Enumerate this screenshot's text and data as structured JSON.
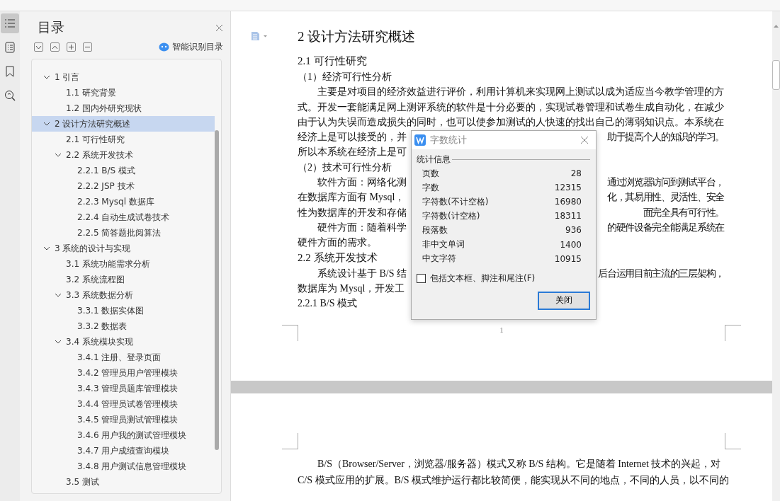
{
  "toc": {
    "title": "目录",
    "smart_button": "智能识别目录",
    "items": [
      {
        "label": "1  引言",
        "expanded": true,
        "selected": false,
        "children": [
          {
            "label": "1.1  研究背景",
            "selected": false
          },
          {
            "label": "1.2  国内外研究现状",
            "selected": false
          }
        ]
      },
      {
        "label": "2  设计方法研究概述",
        "expanded": true,
        "selected": true,
        "children": [
          {
            "label": "2.1  可行性研究",
            "selected": false
          },
          {
            "label": "2.2  系统开发技术",
            "expanded": true,
            "selected": false,
            "children": [
              {
                "label": "2.2.1    B/S 模式",
                "selected": false
              },
              {
                "label": "2.2.2 JSP 技术",
                "selected": false
              },
              {
                "label": "2.2.3 Mysql 数据库",
                "selected": false
              },
              {
                "label": "2.2.4  自动生成试卷技术",
                "selected": false
              },
              {
                "label": "2.2.5  简答题批阅算法",
                "selected": false
              }
            ]
          }
        ]
      },
      {
        "label": "3  系统的设计与实现",
        "expanded": true,
        "selected": false,
        "children": [
          {
            "label": "3.1  系统功能需求分析",
            "selected": false
          },
          {
            "label": "3.2  系统流程图",
            "selected": false
          },
          {
            "label": "3.3  系统数据分析",
            "expanded": true,
            "selected": false,
            "children": [
              {
                "label": "3.3.1    数据实体图",
                "selected": false
              },
              {
                "label": "3.3.2    数据表",
                "selected": false
              }
            ]
          },
          {
            "label": "3.4  系统模块实现",
            "expanded": true,
            "selected": false,
            "children": [
              {
                "label": "3.4.1  注册、登录页面",
                "selected": false
              },
              {
                "label": "3.4.2  管理员用户管理模块",
                "selected": false
              },
              {
                "label": "3.4.3  管理员题库管理模块",
                "selected": false
              },
              {
                "label": "3.4.4  管理员试卷管理模块",
                "selected": false
              },
              {
                "label": "3.4.5  管理员测试管理模块",
                "selected": false
              },
              {
                "label": "3.4.6 用户我的测试管理模块",
                "selected": false
              },
              {
                "label": "3.4.7 用户成绩查询模块",
                "selected": false
              },
              {
                "label": "3.4.8 用户测试信息管理模块",
                "selected": false
              }
            ]
          },
          {
            "label": "3.5  测试",
            "selected": false
          }
        ]
      }
    ]
  },
  "document": {
    "page1_lines": [
      {
        "kind": "h1",
        "text": "2  设计方法研究概述"
      },
      {
        "kind": "h2",
        "text": "2.1  可行性研究"
      },
      {
        "kind": "line",
        "text": "（1）经济可行性分析"
      },
      {
        "kind": "indent",
        "text": "主要是对项目的经济效益进行评价，利用计算机来实现网上测试以成为适应当今教学管理的方"
      },
      {
        "kind": "line",
        "text": "式。开发一套能满足网上测评系统的软件是十分必要的，实现试卷管理和试卷生成自动化，在减少"
      },
      {
        "kind": "line",
        "text": "由于认为失误而造成损失的同时，也可以使参加测试的人快速的找出自己的薄弱知识点。本系统在"
      },
      {
        "kind": "line",
        "text": "经济上是可以接受的，并",
        "right": "助于提高个人的知识的学习。"
      },
      {
        "kind": "line",
        "text": "所以本系统在经济上是可"
      },
      {
        "kind": "line",
        "text": "（2）技术可行性分析"
      },
      {
        "kind": "indent",
        "text": "软件方面：网络化测",
        "right": "通过浏览器访问到测试平台，"
      },
      {
        "kind": "line",
        "text": "在数据库方面有 Mysql，",
        "right": "化，其易用性、灵活性、安全"
      },
      {
        "kind": "line",
        "text": "性为数据库的开发和存储",
        "right": "面完全具有可行性。"
      },
      {
        "kind": "indent",
        "text": "硬件方面：随着科学",
        "right": "的硬件设备完全能满足系统在"
      },
      {
        "kind": "line",
        "text": "硬件方面的需求。"
      },
      {
        "kind": "h2",
        "text": "2.2  系统开发技术"
      },
      {
        "kind": "indent",
        "text": "系统设计基于 B/S 结",
        "right": "后台运用目前主流的三层架构，"
      },
      {
        "kind": "line",
        "text": "数据库为 Mysql，开发工"
      },
      {
        "kind": "line",
        "text": "2.2.1    B/S 模式"
      }
    ],
    "page_number": "1",
    "page2_lines": [
      {
        "kind": "indent",
        "text": "B/S（Browser/Server，浏览器/服务器）模式又称 B/S 结构。它是随着 Internet 技术的兴起，对"
      },
      {
        "kind": "line",
        "text": "C/S 模式应用的扩展。B/S 模式维护运行都比较简便，能实现从不同的地点，不同的人员，以不同的"
      }
    ]
  },
  "dialog": {
    "title": "字数统计",
    "group": "统计信息",
    "stats": [
      {
        "label": "页数",
        "value": "28"
      },
      {
        "label": "字数",
        "value": "12315"
      },
      {
        "label": "字符数(不计空格)",
        "value": "16980"
      },
      {
        "label": "字符数(计空格)",
        "value": "18311"
      },
      {
        "label": "段落数",
        "value": "936"
      },
      {
        "label": "非中文单词",
        "value": "1400"
      },
      {
        "label": "中文字符",
        "value": "10915"
      }
    ],
    "option": {
      "label": "包括文本框、脚注和尾注(F)",
      "checked": false
    },
    "button": "关闭"
  }
}
